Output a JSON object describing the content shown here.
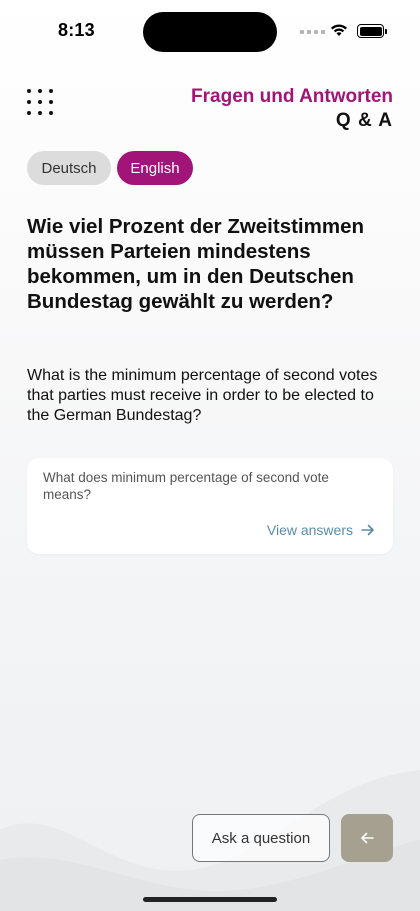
{
  "status": {
    "time": "8:13"
  },
  "header": {
    "title_line1": "Fragen und Antworten",
    "title_line2": "Q & A"
  },
  "languages": [
    {
      "label": "Deutsch",
      "selected": false
    },
    {
      "label": "English",
      "selected": true
    }
  ],
  "question": {
    "german": "Wie viel Prozent der Zweitstimmen müssen Parteien mindestens bekommen, um in den Deutschen Bundestag gewählt zu werden?",
    "english": "What is the minimum percentage of second votes that parties must receive in order to be elected to the German Bundestag?"
  },
  "card": {
    "text": "What does minimum percentage of second vote means?",
    "link_label": "View answers"
  },
  "footer": {
    "ask_label": "Ask a question"
  },
  "colors": {
    "accent": "#a31479",
    "link": "#5a8ca8",
    "back_button": "#a5a08f"
  }
}
